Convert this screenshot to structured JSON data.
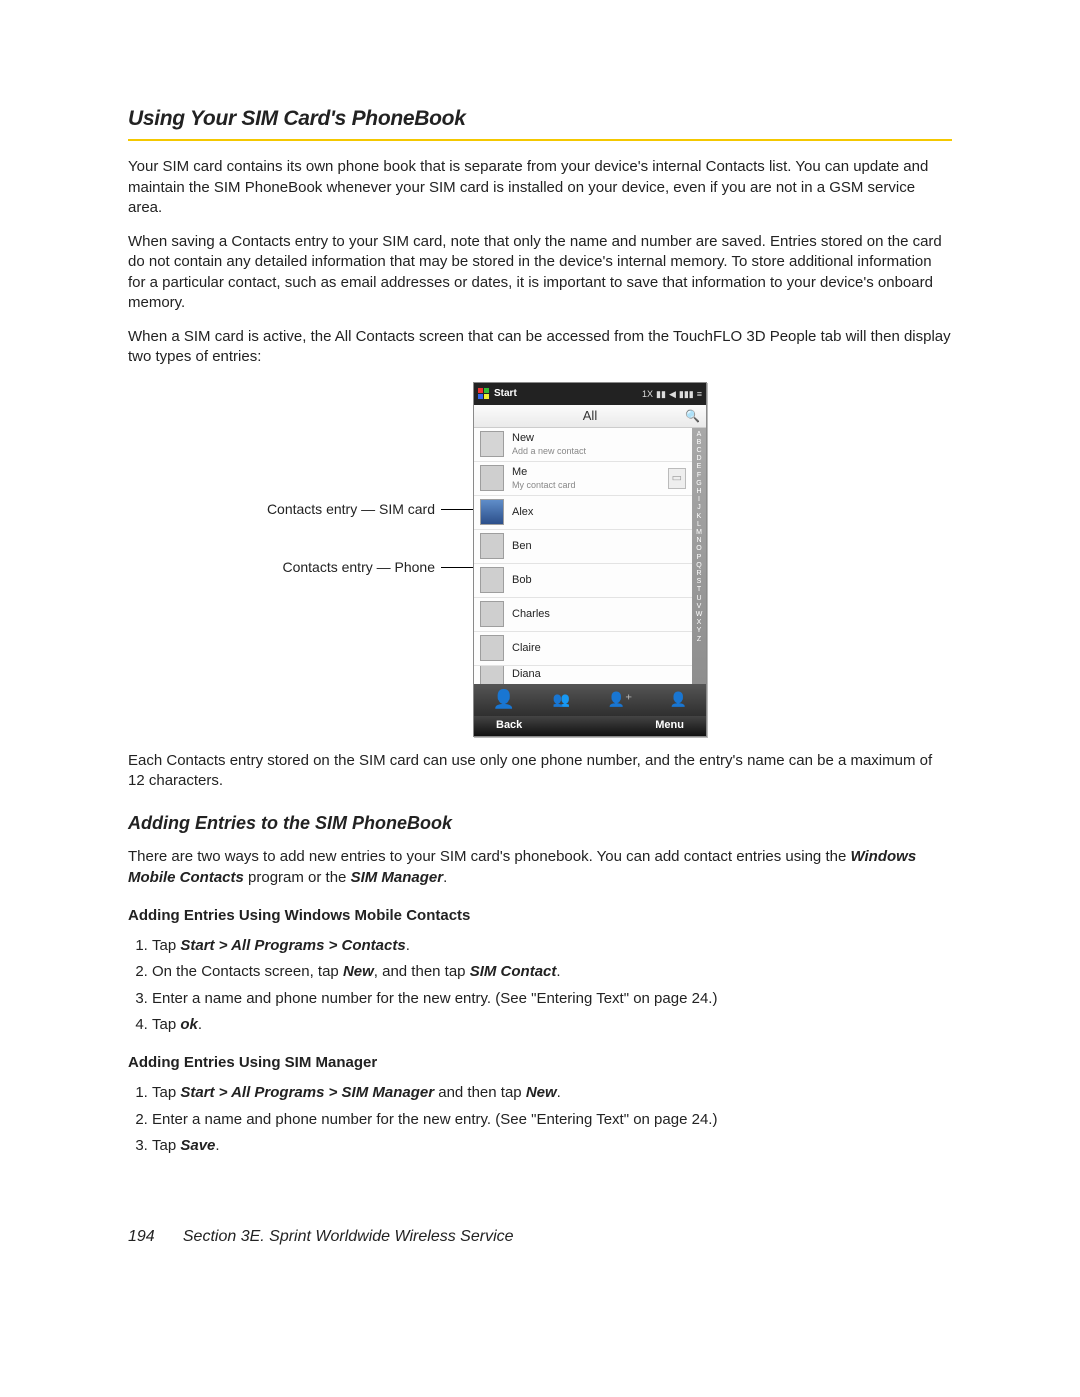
{
  "section_title": "Using Your SIM Card's PhoneBook",
  "para1": "Your SIM card contains its own phone book that is separate from your device's internal Contacts list. You can update and maintain the SIM PhoneBook whenever your SIM card is installed on your device, even if you are not in a GSM service area.",
  "para2": "When saving a Contacts entry to your SIM card, note that only the name and number are saved. Entries stored on the card do not contain any detailed information that may be stored in the device's internal memory. To store additional information for a particular contact, such as email addresses or dates, it is important to save that information to your device's onboard memory.",
  "para3": "When a SIM card is active, the All Contacts screen that can be accessed from the TouchFLO 3D People tab will then display two types of entries:",
  "callout1": "Contacts entry — SIM card",
  "callout2": "Contacts entry — Phone",
  "para4": "Each Contacts entry stored on the SIM card can use only one phone number, and the entry's name can be a maximum of 12 characters.",
  "subsection_title": "Adding Entries to the SIM PhoneBook",
  "para5_pre": "There are two ways to add new entries to your SIM card's phonebook. You can add contact entries using the ",
  "para5_em1": "Windows Mobile Contacts",
  "para5_mid": " program or the ",
  "para5_em2": "SIM Manager",
  "para5_end": ".",
  "head_a": "Adding Entries Using Windows Mobile Contacts",
  "a_steps": {
    "s1_pre": "Tap ",
    "s1_em": "Start > All Programs > Contacts",
    "s1_end": ".",
    "s2_pre": "On the Contacts screen, tap ",
    "s2_em1": "New",
    "s2_mid": ", and then tap ",
    "s2_em2": "SIM Contact",
    "s2_end": ".",
    "s3": "Enter a name and phone number for the new entry. (See \"Entering Text\" on page 24.)",
    "s4_pre": "Tap ",
    "s4_em": "ok",
    "s4_end": "."
  },
  "head_b": "Adding Entries Using SIM Manager",
  "b_steps": {
    "s1_pre": "Tap ",
    "s1_em": "Start > All Programs > SIM Manager",
    "s1_mid": " and then tap ",
    "s1_em2": "New",
    "s1_end": ".",
    "s2": "Enter a name and phone number for the new entry. (See \"Entering Text\" on page 24.)",
    "s3_pre": "Tap ",
    "s3_em": "Save",
    "s3_end": "."
  },
  "footer": {
    "page": "194",
    "section": "Section 3E. Sprint Worldwide Wireless Service"
  },
  "phone": {
    "start": "Start",
    "pivot": "All",
    "items": [
      {
        "line1": "New",
        "line2": "Add a new contact",
        "avatar": "plus"
      },
      {
        "line1": "Me",
        "line2": "My contact card",
        "avatar": "photo",
        "card": true
      },
      {
        "line1": "Alex",
        "avatar": "sim"
      },
      {
        "line1": "Ben",
        "avatar": "photo"
      },
      {
        "line1": "Bob",
        "avatar": "photo"
      },
      {
        "line1": "Charles",
        "avatar": "photo"
      },
      {
        "line1": "Claire",
        "avatar": "photo"
      },
      {
        "line1": "Diana",
        "avatar": "photo",
        "clipped": true
      }
    ],
    "az": "ABCDEFGHIJKLMNOPQRSTUVWXYZ",
    "softleft": "Back",
    "softright": "Menu"
  }
}
